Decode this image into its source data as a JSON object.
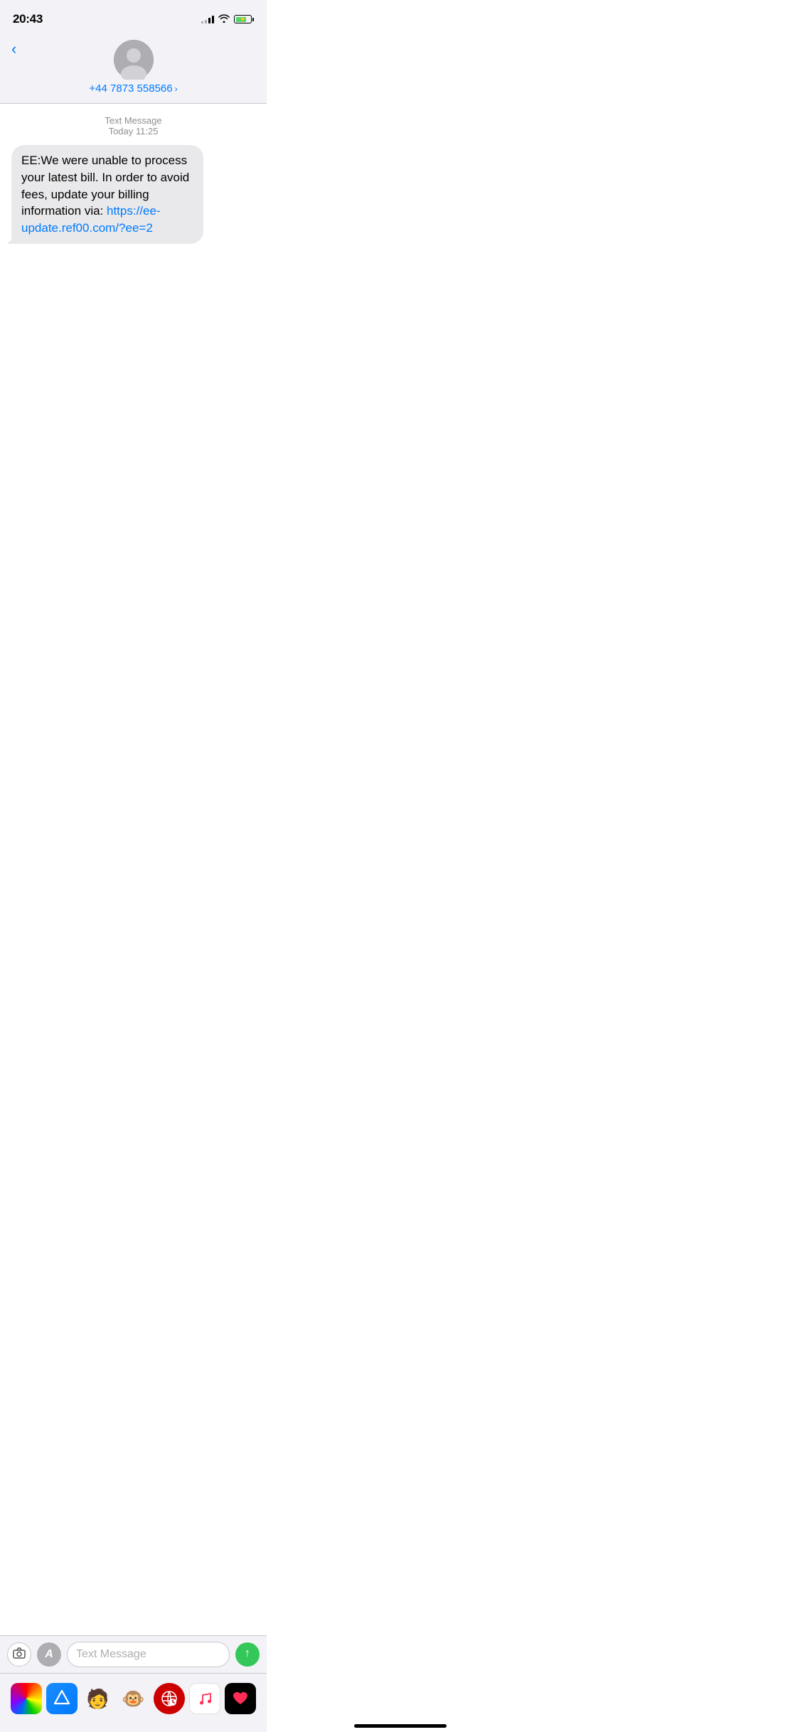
{
  "statusBar": {
    "time": "20:43",
    "signal": [
      1,
      2,
      3,
      4
    ],
    "activeSignalBars": 2,
    "wifi": true,
    "battery": 70,
    "charging": true
  },
  "header": {
    "backLabel": "‹",
    "contactNumber": "+44 7873 558566",
    "chevron": "›"
  },
  "messageMeta": {
    "typeLabel": "Text Message",
    "dateLabel": "Today 11:25"
  },
  "message": {
    "text": "EE:We were unable to process your latest bill. In order to avoid fees, update your billing information via: ",
    "linkText": "https://ee-update.ref00.com/?ee=2",
    "linkHref": "https://ee-update.ref00.com/?ee=2"
  },
  "inputBar": {
    "placeholder": "Text Message",
    "cameraIcon": "📷",
    "appsLabel": "A"
  },
  "dock": {
    "apps": [
      {
        "name": "Photos",
        "emoji": "🌸",
        "type": "photos"
      },
      {
        "name": "App Store",
        "emoji": "🅐",
        "type": "appstore"
      },
      {
        "name": "Memoji",
        "emoji": "🧒",
        "type": "memoji"
      },
      {
        "name": "Monkey",
        "emoji": "🐵",
        "type": "monkey"
      },
      {
        "name": "Web Search",
        "emoji": "🔍",
        "type": "web"
      },
      {
        "name": "Music",
        "emoji": "🎵",
        "type": "music"
      },
      {
        "name": "Heart",
        "emoji": "🩷",
        "type": "heart"
      }
    ]
  }
}
